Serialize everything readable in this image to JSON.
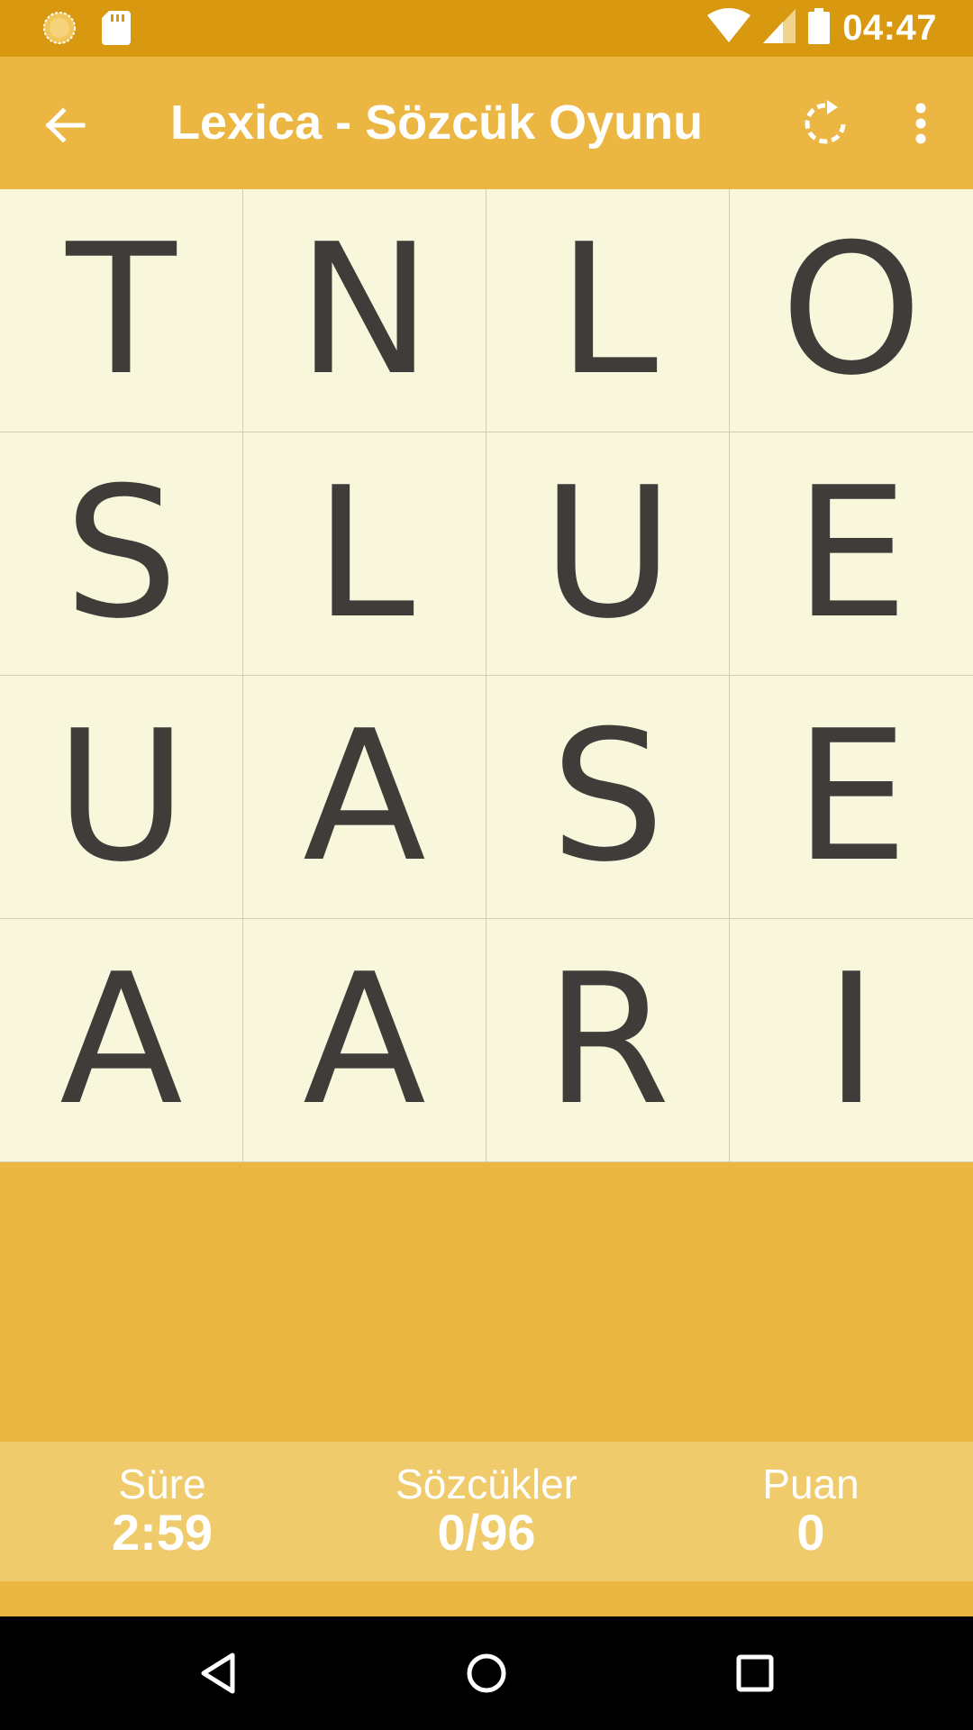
{
  "status_bar": {
    "time": "04:47",
    "left_icons": [
      "sun-icon",
      "sd-card-icon"
    ],
    "right_icons": [
      "wifi-icon",
      "signal-icon",
      "battery-icon"
    ]
  },
  "app_bar": {
    "title": "Lexica - Sözcük Oyunu",
    "back_icon": "arrow-left-icon",
    "refresh_icon": "refresh-icon",
    "menu_icon": "more-vert-icon"
  },
  "board": {
    "rows": [
      [
        "T",
        "N",
        "L",
        "O"
      ],
      [
        "S",
        "L",
        "U",
        "E"
      ],
      [
        "U",
        "A",
        "S",
        "E"
      ],
      [
        "A",
        "A",
        "R",
        "I"
      ]
    ]
  },
  "stats": {
    "time_label": "Süre",
    "time_value": "2:59",
    "words_label": "Sözcükler",
    "words_value": "0/96",
    "score_label": "Puan",
    "score_value": "0"
  },
  "colors": {
    "status_bar": "#D89810",
    "app_bar": "#EBB641",
    "board_bg": "#F8F7DC",
    "letter": "#3F3D39",
    "stats_bg": "#EFCB6C"
  }
}
